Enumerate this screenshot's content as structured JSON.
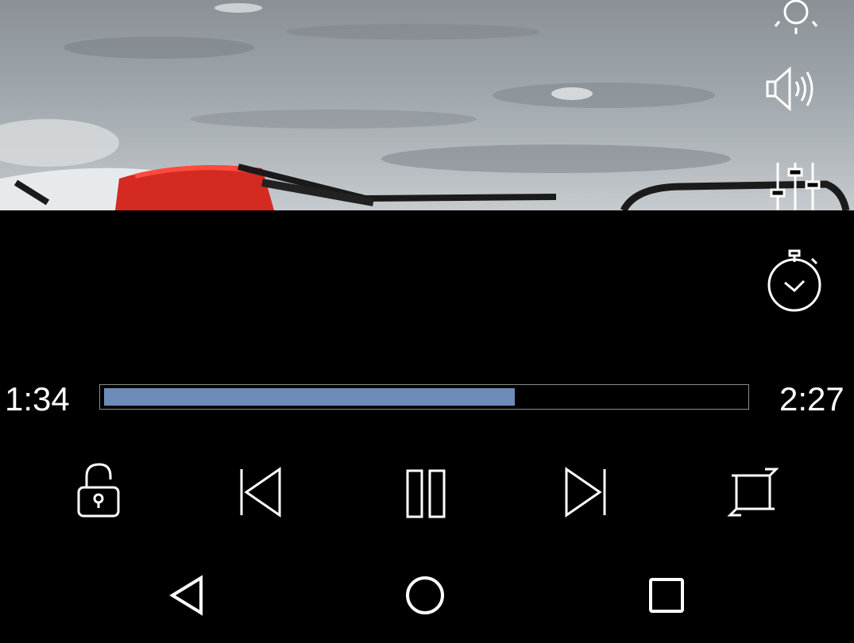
{
  "player": {
    "elapsed": "1:34",
    "duration": "2:27",
    "progress_fraction": 0.64
  },
  "side_controls": {
    "icons": [
      "brightness-icon",
      "volume-icon",
      "equalizer-icon",
      "sleep-timer-icon"
    ]
  },
  "controls": {
    "icons": [
      "unlock-icon",
      "skip-previous-icon",
      "pause-icon",
      "skip-next-icon",
      "crop-icon"
    ]
  },
  "nav_bar": {
    "icons": [
      "back-icon",
      "home-icon",
      "recents-icon"
    ]
  },
  "colors": {
    "accent": "#6c8bb8",
    "background": "#000000",
    "icon": "#ffffff"
  }
}
